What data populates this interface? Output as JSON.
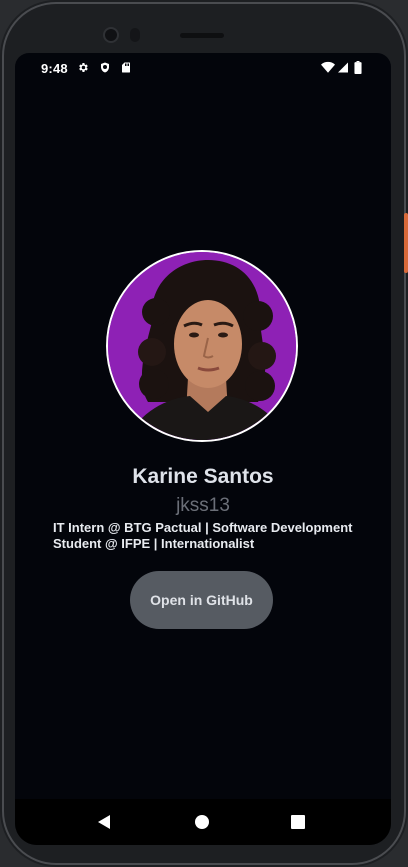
{
  "status_bar": {
    "time": "9:48",
    "left_icons": [
      "settings-gear-icon",
      "shield-icon",
      "sd-card-icon"
    ],
    "right_icons": [
      "wifi-icon",
      "cell-signal-icon",
      "battery-icon"
    ]
  },
  "profile": {
    "name": "Karine Santos",
    "username": "jkss13",
    "bio_line1": "IT Intern @ BTG Pactual | Software Development",
    "bio_line2": "Student @ IFPE | Internationalist",
    "avatar_background": "#8e21b5"
  },
  "actions": {
    "open_github_label": "Open in GitHub"
  },
  "navigation": {
    "buttons": [
      "back-icon",
      "home-icon",
      "recents-icon"
    ]
  },
  "colors": {
    "screen_background": "#03050b",
    "button_background": "#565b62",
    "username_color": "#6b6f78"
  }
}
